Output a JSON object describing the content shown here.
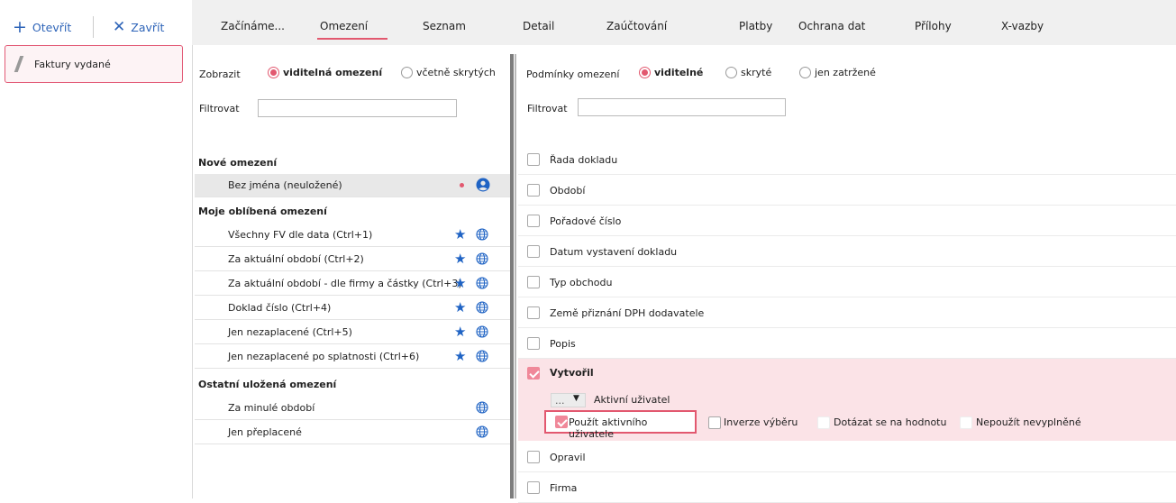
{
  "toolbar": {
    "open_label": "Otevřít",
    "close_label": "Zavřít"
  },
  "agenda": {
    "label": "Faktury vydané"
  },
  "tabs": [
    "Začínáme...",
    "Omezení",
    "Seznam",
    "Detail",
    "Zaúčtování",
    "Platby",
    "Ochrana dat",
    "Přílohy",
    "X-vazby"
  ],
  "active_tab": "Omezení",
  "left": {
    "show_label": "Zobrazit",
    "radio_visible": "viditelná omezení",
    "radio_hidden": "včetně skrytých",
    "filter_label": "Filtrovat",
    "filter_value": "",
    "new_header": "Nové omezení",
    "new_item": "Bez jména (neuložené)",
    "fav_header": "Moje oblíbená omezení",
    "favorites": [
      "Všechny FV dle data (Ctrl+1)",
      "Za aktuální období (Ctrl+2)",
      "Za aktuální období - dle firmy a částky (Ctrl+3)",
      "Doklad číslo (Ctrl+4)",
      "Jen nezaplacené (Ctrl+5)",
      "Jen nezaplacené po splatnosti (Ctrl+6)"
    ],
    "other_header": "Ostatní uložená omezení",
    "others": [
      "Za minulé období",
      "Jen přeplacené"
    ]
  },
  "right": {
    "cond_label": "Podmínky omezení",
    "radio_visible": "viditelné",
    "radio_hidden": "skryté",
    "radio_filled": "jen zatržené",
    "filter_label": "Filtrovat",
    "filter_value": "",
    "conditions": [
      "Řada dokladu",
      "Období",
      "Pořadové číslo",
      "Datum vystavení dokladu",
      "Typ obchodu",
      "Země přiznání DPH dodavatele",
      "Popis"
    ],
    "expanded": {
      "title": "Vytvořil",
      "dots": "...",
      "user_label": "Aktivní uživatel",
      "use_active": "Použít aktivního uživatele",
      "inverse": "Inverze výběru",
      "ask": "Dotázat se na hodnotu",
      "no_empty": "Nepoužít nevyplněné"
    },
    "conditions_after": [
      "Opravil",
      "Firma"
    ]
  },
  "colors": {
    "accent": "#e2586f",
    "link": "#2e64b8",
    "star": "#1f63c4"
  }
}
